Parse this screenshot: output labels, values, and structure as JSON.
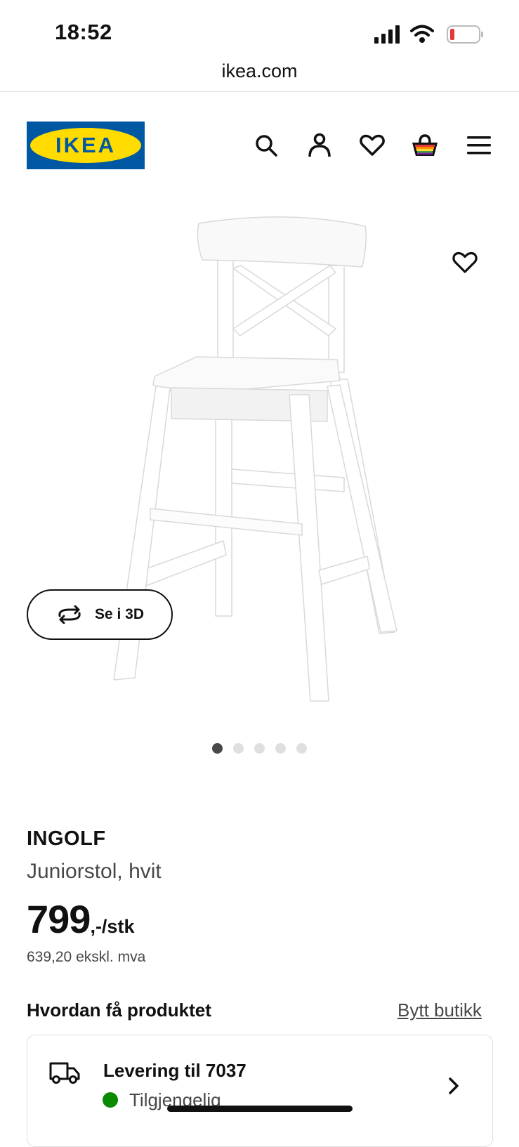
{
  "status_bar": {
    "time": "18:52"
  },
  "browser": {
    "url": "ikea.com"
  },
  "header": {
    "logo_text": "IKEA",
    "icons": [
      "search-icon",
      "account-icon",
      "favourites-icon",
      "cart-icon",
      "menu-icon"
    ]
  },
  "gallery": {
    "view_3d_label": "Se i 3D",
    "dot_count": 5,
    "active_dot": 1
  },
  "product": {
    "name": "INGOLF",
    "description": "Juniorstol, hvit",
    "price": "799",
    "price_suffix": ",-/stk",
    "price_ex_vat": "639,20 ekskl. mva"
  },
  "fulfillment": {
    "title": "Hvordan få produktet",
    "change_store": "Bytt butikk",
    "delivery_title": "Levering til 7037",
    "availability": "Tilgjengelig"
  },
  "colors": {
    "brand_blue": "#0058a3",
    "brand_yellow": "#ffdb00",
    "available_green": "#0a8a00"
  }
}
